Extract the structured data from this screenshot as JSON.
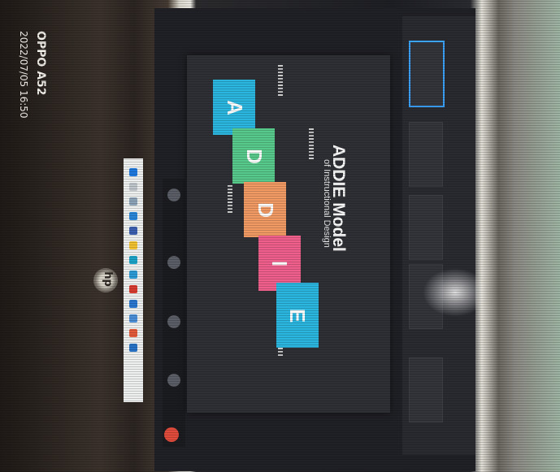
{
  "photo": {
    "camera_model": "OPPO A52",
    "timestamp": "2022/07/05 16:50",
    "laptop_logo": "hp"
  },
  "slide": {
    "title": "ADDIE Model",
    "subtitle": "of Instructional Design",
    "letters": [
      {
        "letter": "A",
        "color": "#2bb6e0"
      },
      {
        "letter": "D",
        "color": "#57c98a"
      },
      {
        "letter": "D",
        "color": "#f19a63"
      },
      {
        "letter": "I",
        "color": "#ef5f8c"
      },
      {
        "letter": "E",
        "color": "#2bb6e0"
      }
    ]
  },
  "colors": {
    "screen_bg": "#202126",
    "slide_bg": "#2e3035",
    "active_tile_border": "#3aa4ff",
    "end_call": "#e04b3c"
  },
  "icons": [
    "windows-start-icon",
    "search-icon",
    "file-explorer-icon",
    "edge-browser-icon",
    "chrome-icon",
    "end-call-icon",
    "microphone-icon",
    "camera-icon"
  ]
}
